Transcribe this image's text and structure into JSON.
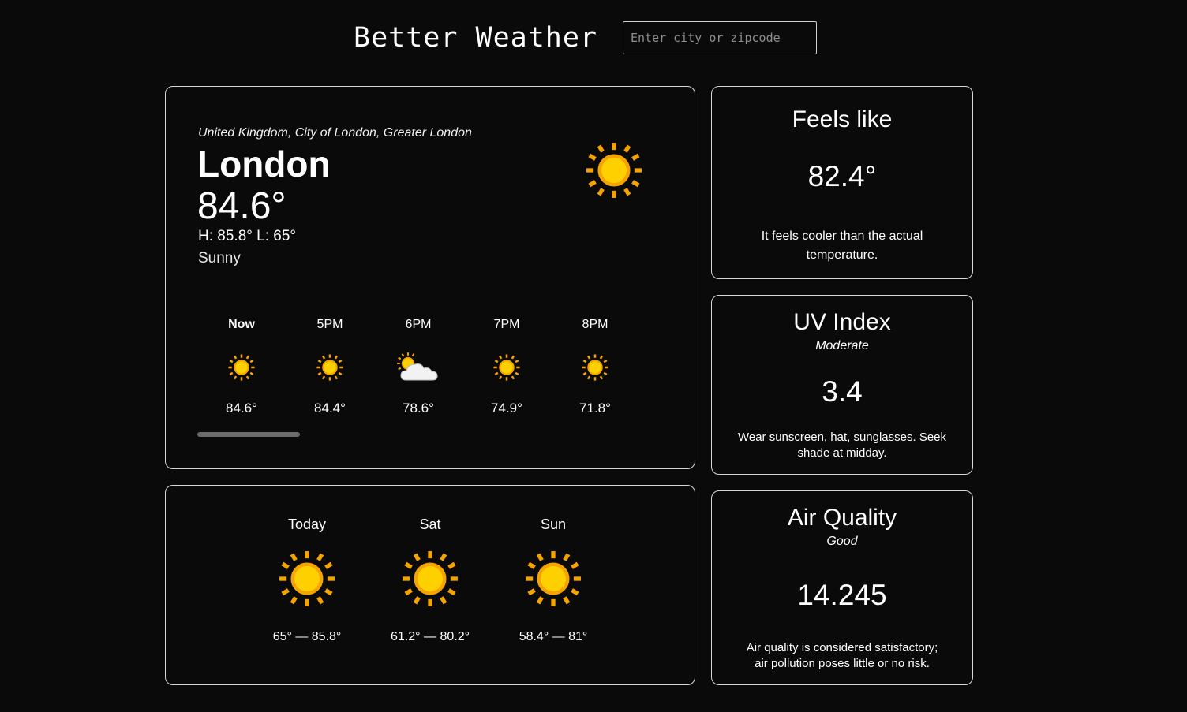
{
  "app": {
    "title": "Better Weather"
  },
  "search": {
    "placeholder": "Enter city or zipcode",
    "value": ""
  },
  "current": {
    "location": "United Kingdom, City of London, Greater London",
    "city": "London",
    "temp": "84.6°",
    "hilo": "H: 85.8° L: 65°",
    "condition": "Sunny",
    "icon": "sun-icon"
  },
  "hourly": [
    {
      "time": "Now",
      "icon": "sun-icon",
      "temp": "84.6°"
    },
    {
      "time": "5PM",
      "icon": "sun-icon",
      "temp": "84.4°"
    },
    {
      "time": "6PM",
      "icon": "partly-cloudy-icon",
      "temp": "78.6°"
    },
    {
      "time": "7PM",
      "icon": "sun-icon",
      "temp": "74.9°"
    },
    {
      "time": "8PM",
      "icon": "sun-icon",
      "temp": "71.8°"
    }
  ],
  "daily": [
    {
      "day": "Today",
      "icon": "sun-icon",
      "range": "65° — 85.8°"
    },
    {
      "day": "Sat",
      "icon": "sun-icon",
      "range": "61.2° — 80.2°"
    },
    {
      "day": "Sun",
      "icon": "sun-icon",
      "range": "58.4° — 81°"
    }
  ],
  "feels_like": {
    "title": "Feels like",
    "value": "82.4°",
    "description": "It feels cooler than the actual temperature."
  },
  "uv": {
    "title": "UV Index",
    "level": "Moderate",
    "value": "3.4",
    "description": "Wear sunscreen, hat, sunglasses. Seek shade at midday."
  },
  "air_quality": {
    "title": "Air Quality",
    "level": "Good",
    "value": "14.245",
    "description": "Air quality is considered satisfactory; air pollution poses little or no risk."
  },
  "colors": {
    "background": "#0a0a0a",
    "border": "#d6d6d6",
    "sun_ray": "#f4a300",
    "sun_core": "#ffd000",
    "cloud": "#f2f2f2"
  }
}
